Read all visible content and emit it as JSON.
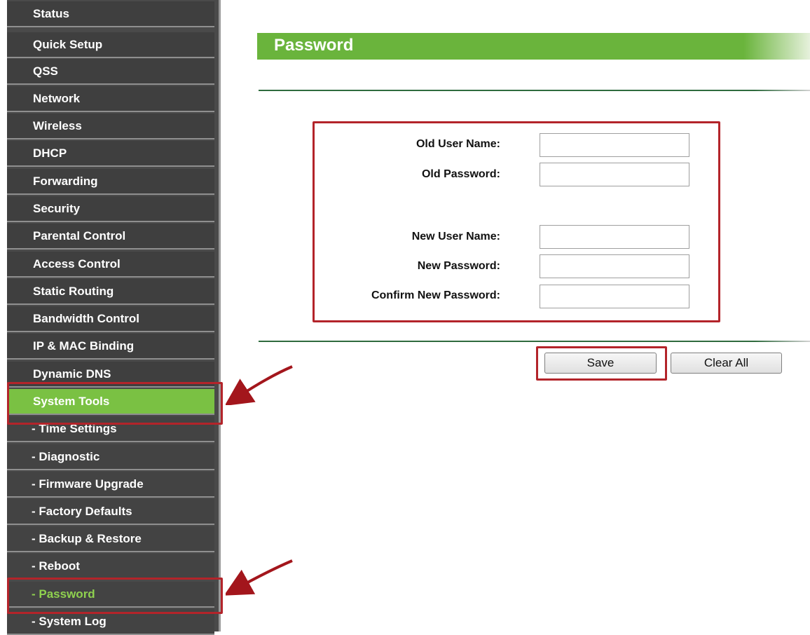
{
  "sidebar": {
    "items": [
      {
        "label": "Status"
      },
      {
        "label": "Quick Setup"
      },
      {
        "label": "QSS"
      },
      {
        "label": "Network"
      },
      {
        "label": "Wireless"
      },
      {
        "label": "DHCP"
      },
      {
        "label": "Forwarding"
      },
      {
        "label": "Security"
      },
      {
        "label": "Parental Control"
      },
      {
        "label": "Access Control"
      },
      {
        "label": "Static Routing"
      },
      {
        "label": "Bandwidth Control"
      },
      {
        "label": "IP & MAC Binding"
      },
      {
        "label": "Dynamic DNS"
      },
      {
        "label": "System Tools"
      },
      {
        "label": "- Time Settings"
      },
      {
        "label": "- Diagnostic"
      },
      {
        "label": "- Firmware Upgrade"
      },
      {
        "label": "- Factory Defaults"
      },
      {
        "label": "- Backup & Restore"
      },
      {
        "label": "- Reboot"
      },
      {
        "label": "- Password"
      },
      {
        "label": "- System Log"
      }
    ],
    "active_color": "#7ac143",
    "current_sub_color": "#8fd14f"
  },
  "main": {
    "title": "Password",
    "form": {
      "old_user_name_label": "Old User Name:",
      "old_user_name_value": "",
      "old_password_label": "Old Password:",
      "old_password_value": "",
      "new_user_name_label": "New User Name:",
      "new_user_name_value": "",
      "new_password_label": "New Password:",
      "new_password_value": "",
      "confirm_new_password_label": "Confirm New Password:",
      "confirm_new_password_value": ""
    },
    "buttons": {
      "save_label": "Save",
      "clear_all_label": "Clear All"
    }
  },
  "colors": {
    "accent": "#6ab43c",
    "annotation": "#b3242a"
  }
}
